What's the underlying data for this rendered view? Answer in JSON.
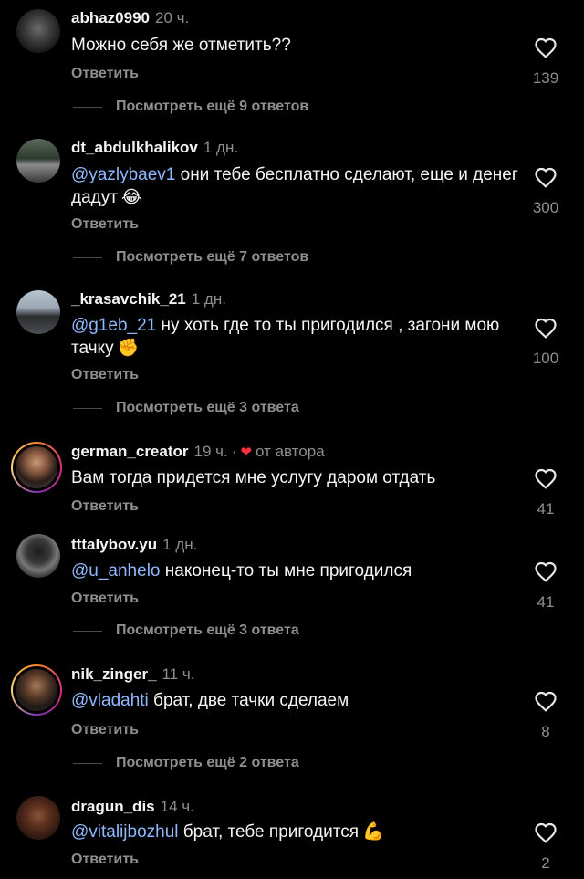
{
  "colors": {
    "background": "#000000",
    "text": "#f5f5f5",
    "muted": "#8e8e8e",
    "mention": "#8fb8ff",
    "heart_red": "#ff3040"
  },
  "comments": [
    {
      "username": "abhaz0990",
      "time": "20 ч.",
      "mention": "",
      "text": "Можно себя же отметить??",
      "emoji": "",
      "reply_label": "Ответить",
      "likes": "139",
      "more_replies": "Посмотреть ещё 9 ответов"
    },
    {
      "username": "dt_abdulkhalikov",
      "time": "1 дн.",
      "mention": "@yazlybaev1",
      "text": " они тебе бесплатно сделают, еще и денег дадут",
      "emoji": "😂",
      "reply_label": "Ответить",
      "likes": "300",
      "more_replies": "Посмотреть ещё 7 ответов"
    },
    {
      "username": "_krasavchik_21",
      "time": "1 дн.",
      "mention": "@g1eb_21",
      "text": " ну хоть где то ты пригодился , загони мою тачку",
      "emoji": "✊",
      "reply_label": "Ответить",
      "likes": "100",
      "more_replies": "Посмотреть ещё 3 ответа"
    },
    {
      "username": "german_creator",
      "time": "19 ч.",
      "dot": "·",
      "author_heart": "❤",
      "author_label": "от автора",
      "mention": "",
      "text": "Вам тогда придется мне услугу даром отдать",
      "emoji": "",
      "reply_label": "Ответить",
      "likes": "41"
    },
    {
      "username": "tttalybov.yu",
      "time": "1 дн.",
      "mention": "@u_anhelo",
      "text": " наконец-то ты мне пригодился",
      "emoji": "",
      "reply_label": "Ответить",
      "likes": "41",
      "more_replies": "Посмотреть ещё 3 ответа"
    },
    {
      "username": "nik_zinger_",
      "time": "11 ч.",
      "mention": "@vladahti",
      "text": " брат, две тачки сделаем",
      "emoji": "",
      "reply_label": "Ответить",
      "likes": "8",
      "more_replies": "Посмотреть ещё 2 ответа"
    },
    {
      "username": "dragun_dis",
      "time": "14 ч.",
      "mention": "@vitalijbozhul",
      "text": " брат, тебе пригодится",
      "emoji": "💪",
      "reply_label": "Ответить",
      "likes": "2"
    }
  ]
}
